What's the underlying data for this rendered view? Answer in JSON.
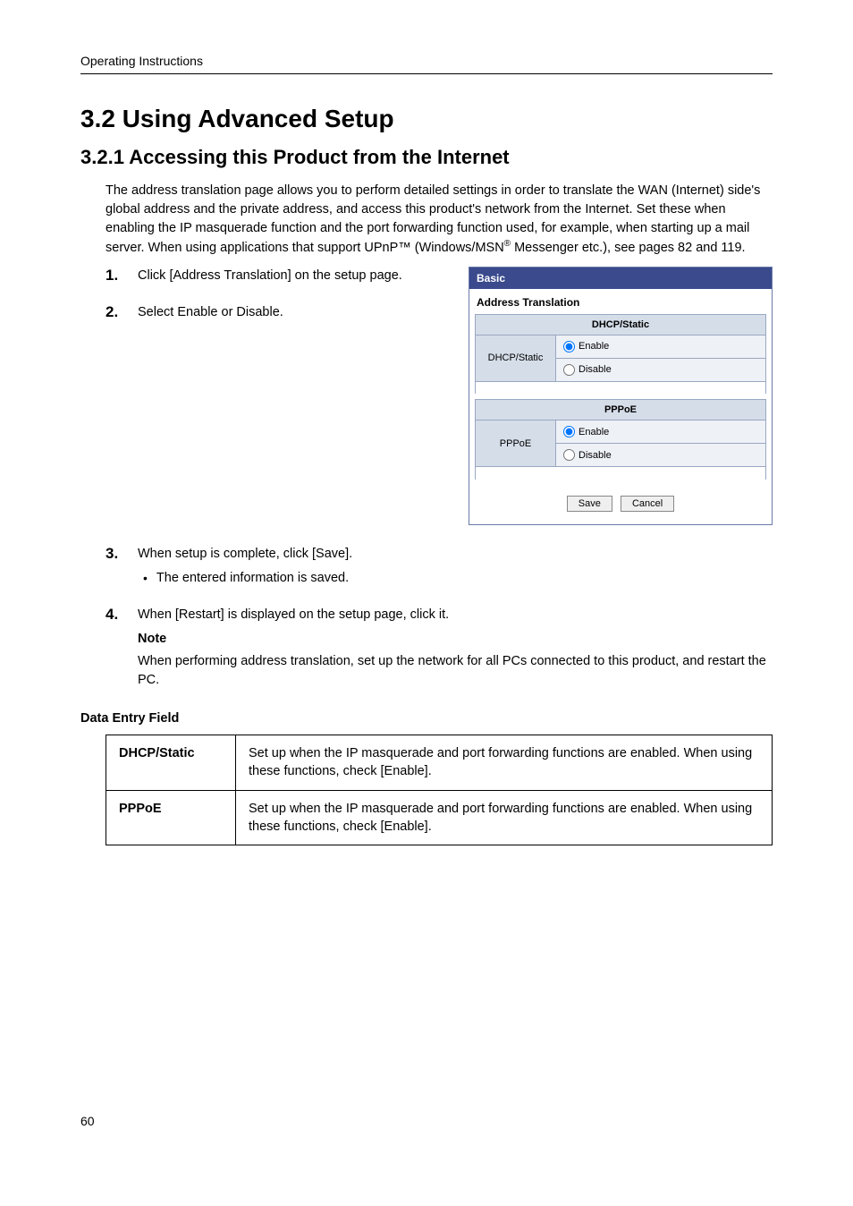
{
  "header": {
    "label": "Operating Instructions"
  },
  "h1": "3.2    Using Advanced Setup",
  "h2": "3.2.1    Accessing this Product from the Internet",
  "intro_parts": {
    "p1": "The address translation page allows you to perform detailed settings in order to translate the WAN (Internet) side's global address and the private address, and access this product's network from the Internet. Set these when enabling the IP masquerade function and the port forwarding function used, for example, when starting up a mail server. When using applications that support UPnP™ (Windows/MSN",
    "sup": "®",
    "p2": " Messenger etc.), see pages 82 and 119."
  },
  "steps": {
    "s1": {
      "num": "1.",
      "text": "Click [Address Translation] on the setup page."
    },
    "s2": {
      "num": "2.",
      "text": "Select Enable or Disable."
    },
    "s3": {
      "num": "3.",
      "text": "When setup is complete, click [Save].",
      "bullet": "The entered information is saved."
    },
    "s4": {
      "num": "4.",
      "text": "When [Restart] is displayed on the setup page, click it."
    }
  },
  "note": {
    "label": "Note",
    "text": "When performing address translation, set up the network for all PCs connected to this product, and restart the PC."
  },
  "panel": {
    "title": "Basic",
    "section": "Address Translation",
    "group1": {
      "header": "DHCP/Static",
      "row_label": "DHCP/Static",
      "opt_enable": "Enable",
      "opt_disable": "Disable"
    },
    "group2": {
      "header": "PPPoE",
      "row_label": "PPPoE",
      "opt_enable": "Enable",
      "opt_disable": "Disable"
    },
    "buttons": {
      "save": "Save",
      "cancel": "Cancel"
    }
  },
  "data_entry": {
    "heading": "Data Entry Field",
    "rows": [
      {
        "label": "DHCP/Static",
        "desc": "Set up when the IP masquerade and port forwarding functions are enabled. When using these functions, check [Enable]."
      },
      {
        "label": "PPPoE",
        "desc": "Set up when the IP masquerade and port forwarding functions are enabled. When using these functions, check [Enable]."
      }
    ]
  },
  "page_number": "60"
}
